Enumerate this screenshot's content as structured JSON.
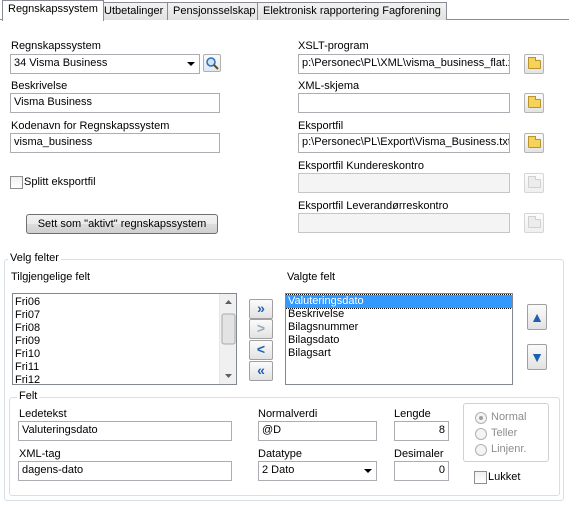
{
  "tabs": [
    {
      "label": "Regnskapssystem",
      "active": true
    },
    {
      "label": "Utbetalinger",
      "active": false
    },
    {
      "label": "Pensjonsselskap",
      "active": false
    },
    {
      "label": "Elektronisk rapportering Fagforening",
      "active": false
    }
  ],
  "left": {
    "system_label": "Regnskapssystem",
    "system_value": "34 Visma Business",
    "description_label": "Beskrivelse",
    "description_value": "Visma Business",
    "codename_label": "Kodenavn for Regnskapssystem",
    "codename_value": "visma_business",
    "split_label": "Splitt eksportfil",
    "active_button": "Sett som \"aktivt\" regnskapssystem"
  },
  "right": {
    "xslt_label": "XSLT-program",
    "xslt_value": "p:\\Personec\\PL\\XML\\visma_business_flat.x",
    "xml_label": "XML-skjema",
    "xml_value": "",
    "export_label": "Eksportfil",
    "export_value": "p:\\Personec\\PL\\Export\\Visma_Business.txt",
    "customer_label": "Eksportfil Kundereskontro",
    "customer_value": "",
    "supplier_label": "Eksportfil Leverandørreskontro",
    "supplier_value": ""
  },
  "fields": {
    "group_label": "Velg felter",
    "available_label": "Tilgjengelige felt",
    "available": [
      "Fri06",
      "Fri07",
      "Fri08",
      "Fri09",
      "Fri10",
      "Fri11",
      "Fri12"
    ],
    "selected_label": "Valgte felt",
    "selected": [
      "Valuteringsdato",
      "Beskrivelse",
      "Bilagsnummer",
      "Bilagsdato",
      "Bilagsart"
    ],
    "selected_index": 0
  },
  "felt": {
    "group_label": "Felt",
    "ledetekst_label": "Ledetekst",
    "ledetekst_value": "Valuteringsdato",
    "normalverdi_label": "Normalverdi",
    "normalverdi_value": "@D",
    "lengde_label": "Lengde",
    "lengde_value": "8",
    "xmltag_label": "XML-tag",
    "xmltag_value": "dagens-dato",
    "datatype_label": "Datatype",
    "datatype_value": "2 Dato",
    "desimaler_label": "Desimaler",
    "desimaler_value": "0",
    "radio_normal": "Normal",
    "radio_teller": "Teller",
    "radio_linjenr": "Linjenr.",
    "lukket_label": "Lukket"
  },
  "icons": {
    "add_all": "»",
    "add": ">",
    "remove": "<",
    "remove_all": "«",
    "up": "▲",
    "down": "▼"
  }
}
